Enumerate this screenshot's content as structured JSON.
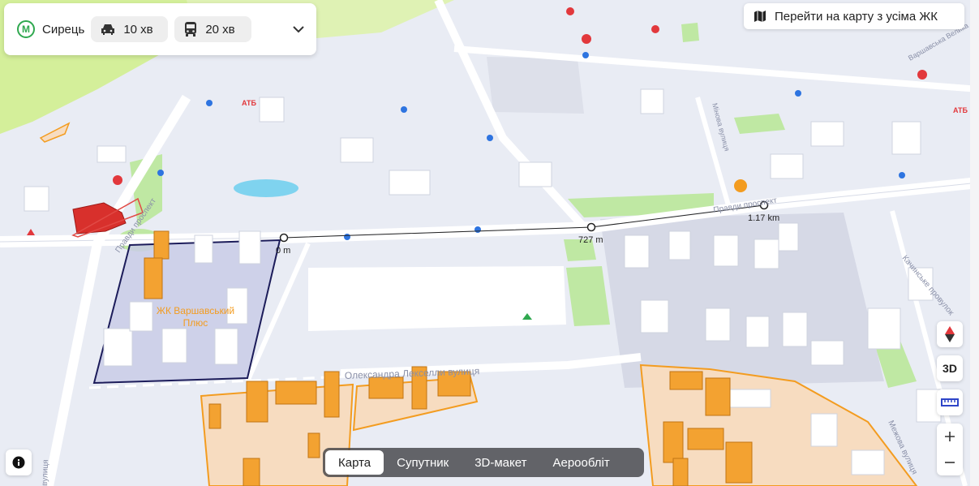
{
  "header": {
    "station": "Сирець",
    "metro_icon": "metro-icon",
    "car_time": "10 хв",
    "bus_time": "20 хв"
  },
  "all_map_button": {
    "label": "Перейти на карту з усіма ЖК"
  },
  "controls": {
    "view_3d": "3D"
  },
  "layers": {
    "tabs": [
      {
        "label": "Карта",
        "active": true
      },
      {
        "label": "Супутник",
        "active": false
      },
      {
        "label": "3D-макет",
        "active": false
      },
      {
        "label": "Аерообліт",
        "active": false
      }
    ]
  },
  "map": {
    "complex_name_line1": "ЖК Варшавський",
    "complex_name_line2": "Плюс",
    "distance_labels": [
      "0 m",
      "727 m",
      "1.17 km"
    ],
    "streets": [
      "Олександра Лекселли вулиця",
      "Правди проспект",
      "Правди проспект",
      "Варшавська Велика",
      "Качинське провулок",
      "Межова вулиця",
      "Мінова вулиця",
      "вулиця"
    ],
    "poi_labels": [
      "АТБ",
      "АТБ"
    ],
    "colors": {
      "highlight_fill": "#c9cde6",
      "highlight_stroke": "#1c1c5a",
      "orange": "#f39c20",
      "red": "#d8302c",
      "green": "#bfe8a3"
    }
  }
}
